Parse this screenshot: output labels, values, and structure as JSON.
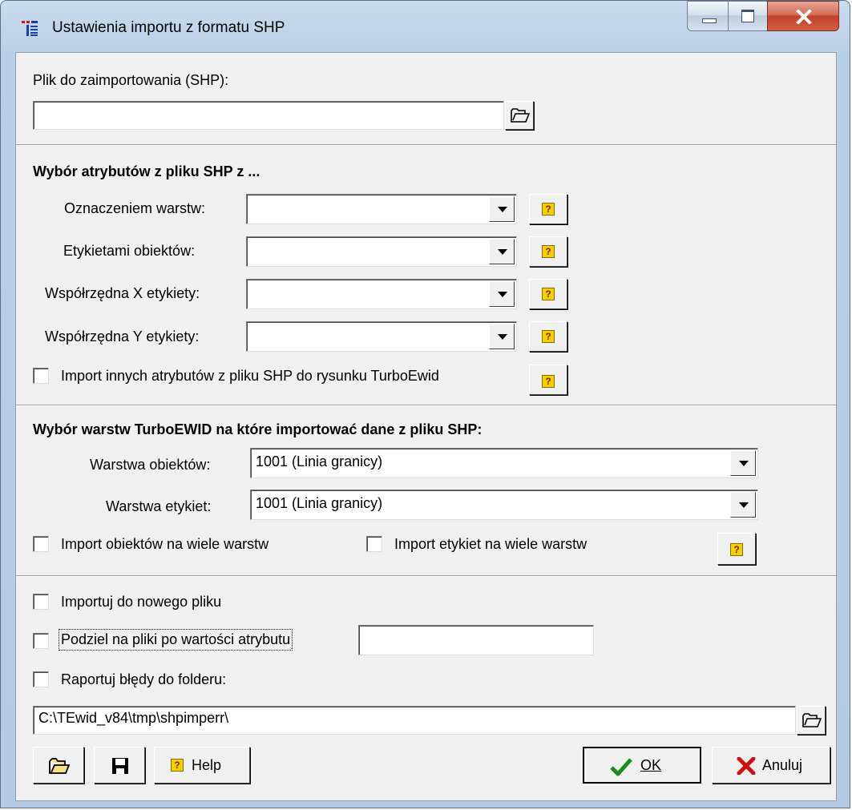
{
  "window": {
    "title": "Ustawienia importu z formatu SHP"
  },
  "file": {
    "label": "Plik do zaimportowania (SHP):",
    "value": ""
  },
  "attributes": {
    "heading": "Wybór atrybutów z pliku SHP z ...",
    "rows": [
      {
        "label": "Oznaczeniem warstw:",
        "value": ""
      },
      {
        "label": "Etykietami obiektów:",
        "value": ""
      },
      {
        "label": "Współrzędna X etykiety:",
        "value": ""
      },
      {
        "label": "Współrzędna Y etykiety:",
        "value": ""
      }
    ],
    "import_other": "Import innych atrybutów z pliku SHP do rysunku TurboEwid"
  },
  "layers": {
    "heading": "Wybór warstw TurboEWID na które importować dane z pliku SHP:",
    "objects_label": "Warstwa obiektów:",
    "objects_value": "1001 (Linia granicy)",
    "labels_label": "Warstwa etykiet:",
    "labels_value": "1001 (Linia granicy)",
    "multi_objects": "Import obiektów na wiele warstw",
    "multi_labels": "Import etykiet na wiele warstw"
  },
  "options": {
    "new_file": "Importuj do nowego pliku",
    "split": "Podziel na pliki po wartości atrybutu",
    "split_value": "",
    "report": "Raportuj błędy do folderu:",
    "report_path": "C:\\TEwid_v84\\tmp\\shpimperr\\"
  },
  "buttons": {
    "help": "Help",
    "ok": "OK",
    "cancel": "Anuluj"
  },
  "colors": {
    "ok_check": "#1d8a1d",
    "cancel_x": "#cc1010",
    "help_icon": "#f5d000"
  }
}
